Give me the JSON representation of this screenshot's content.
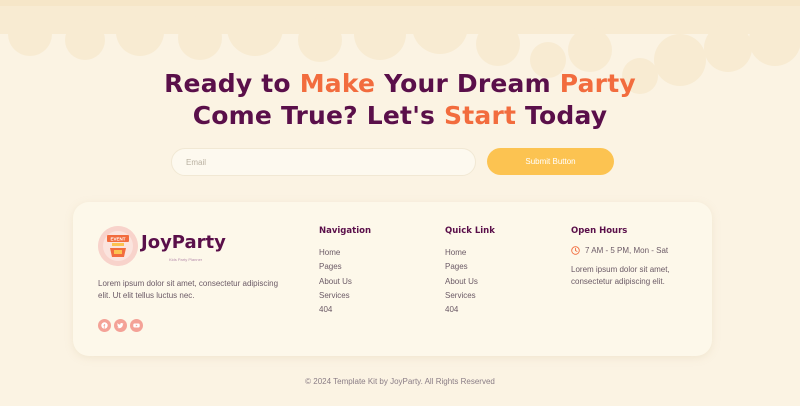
{
  "hero": {
    "line1_a": "Ready to ",
    "line1_b": "Make",
    "line1_c": " Your Dream ",
    "line1_d": "Party",
    "line2_a": "Come True? Let's ",
    "line2_b": "Start",
    "line2_c": " Today"
  },
  "subscribe": {
    "email_placeholder": "Email",
    "email_value": "",
    "submit_label": "Submit Button"
  },
  "brand": {
    "name": "JoyParty",
    "tagline": "Kids Party Planner",
    "badge_text": "EVENT",
    "about": "Lorem ipsum dolor sit amet, consectetur adipiscing elit. Ut elit tellus luctus nec."
  },
  "socials": [
    "facebook-icon",
    "twitter-icon",
    "youtube-icon"
  ],
  "navigation": {
    "title": "Navigation",
    "links": [
      "Home",
      "Pages",
      "About Us",
      "Services",
      "404"
    ]
  },
  "quick_link": {
    "title": "Quick Link",
    "links": [
      "Home",
      "Pages",
      "About Us",
      "Services",
      "404"
    ]
  },
  "open_hours": {
    "title": "Open Hours",
    "time": "7 AM - 5 PM, Mon - Sat",
    "text": "Lorem ipsum dolor sit amet, consectetur adipiscing elit."
  },
  "colors": {
    "background": "#fbf3e3",
    "heading": "#5a0f4a",
    "accent": "#f26c3e",
    "button": "#fcc351",
    "social": "#f4a297"
  },
  "footer": {
    "copyright": "© 2024 Template Kit by JoyParty. All Rights Reserved"
  }
}
